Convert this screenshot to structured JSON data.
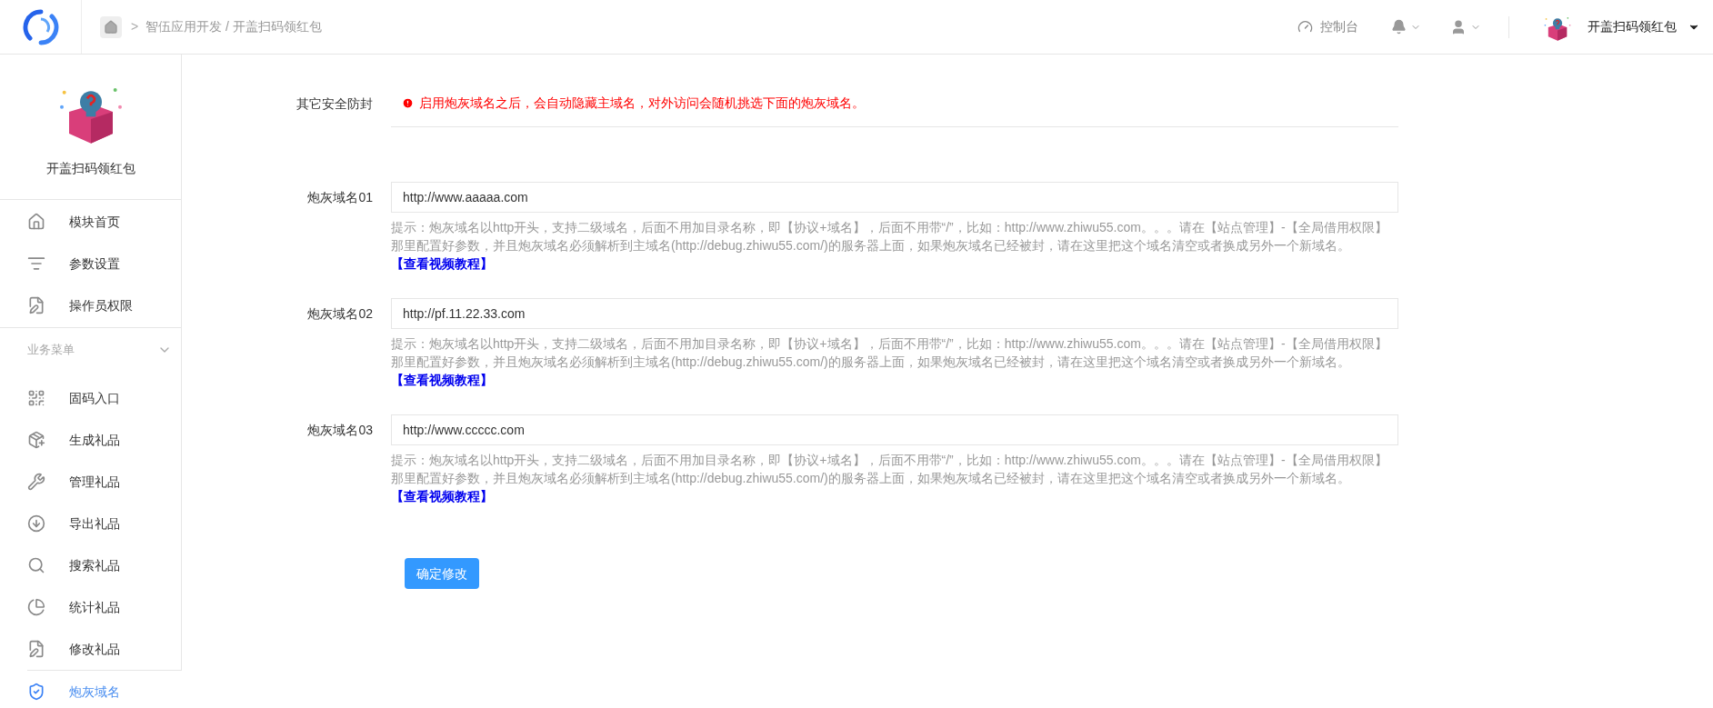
{
  "header": {
    "breadcrumb": [
      ">",
      "智伍应用开发 / 开盖扫码领红包"
    ],
    "console": "控制台",
    "user_name": "开盖扫码领红包"
  },
  "sidebar": {
    "app_name": "开盖扫码领红包",
    "top_items": [
      {
        "label": "模块首页",
        "selected": false
      },
      {
        "label": "参数设置",
        "selected": false
      },
      {
        "label": "操作员权限",
        "selected": false
      }
    ],
    "section": {
      "title": "业务菜单",
      "expanded": true
    },
    "items": [
      {
        "label": "固码入口",
        "selected": false
      },
      {
        "label": "生成礼品",
        "selected": false
      },
      {
        "label": "管理礼品",
        "selected": false
      },
      {
        "label": "导出礼品",
        "selected": false
      },
      {
        "label": "搜索礼品",
        "selected": false
      },
      {
        "label": "统计礼品",
        "selected": false
      },
      {
        "label": "修改礼品",
        "selected": false
      },
      {
        "label": "炮灰域名",
        "selected": true
      }
    ]
  },
  "form": {
    "notice": {
      "label": "其它安全防封",
      "text": "启用炮灰域名之后，会自动隐藏主域名，对外访问会随机挑选下面的炮灰域名。"
    },
    "fields": [
      {
        "label": "炮灰域名01",
        "value": "http://www.aaaaa.com",
        "hint": "提示：炮灰域名以http开头，支持二级域名，后面不用加目录名称，即【协议+域名】，后面不用带“/”，比如：http://www.zhiwu55.com。。。请在【站点管理】-【全局借用权限】那里配置好参数，并且炮灰域名必须解析到主域名(http://debug.zhiwu55.com/)的服务器上面，如果炮灰域名已经被封，请在这里把这个域名清空或者换成另外一个新域名。",
        "link": "【查看视频教程】"
      },
      {
        "label": "炮灰域名02",
        "value": "http://pf.11.22.33.com",
        "hint": "提示：炮灰域名以http开头，支持二级域名，后面不用加目录名称，即【协议+域名】，后面不用带“/”，比如：http://www.zhiwu55.com。。。请在【站点管理】-【全局借用权限】那里配置好参数，并且炮灰域名必须解析到主域名(http://debug.zhiwu55.com/)的服务器上面，如果炮灰域名已经被封，请在这里把这个域名清空或者换成另外一个新域名。",
        "link": "【查看视频教程】"
      },
      {
        "label": "炮灰域名03",
        "value": "http://www.ccccc.com",
        "hint": "提示：炮灰域名以http开头，支持二级域名，后面不用加目录名称，即【协议+域名】，后面不用带“/”，比如：http://www.zhiwu55.com。。。请在【站点管理】-【全局借用权限】那里配置好参数，并且炮灰域名必须解析到主域名(http://debug.zhiwu55.com/)的服务器上面，如果炮灰域名已经被封，请在这里把这个域名清空或者换成另外一个新域名。",
        "link": "【查看视频教程】"
      }
    ],
    "submit": "确定修改"
  }
}
